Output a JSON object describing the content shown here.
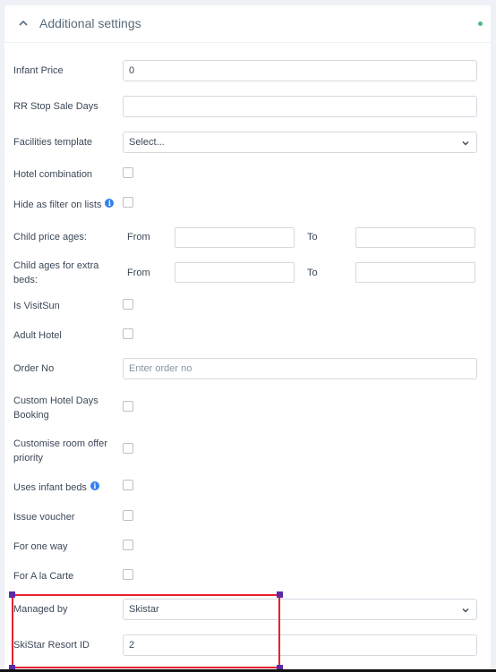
{
  "panel": {
    "title": "Additional settings",
    "status_color": "#52b788"
  },
  "fields": {
    "infant_price": {
      "label": "Infant Price",
      "value": "0"
    },
    "rr_stop_sale_days": {
      "label": "RR Stop Sale Days",
      "value": ""
    },
    "facilities_template": {
      "label": "Facilities template",
      "value": "Select..."
    },
    "hotel_combination": {
      "label": "Hotel combination",
      "checked": false
    },
    "hide_as_filter": {
      "label": "Hide as filter on lists",
      "checked": false,
      "info_icon": "i"
    },
    "child_price_ages": {
      "label": "Child price ages:",
      "from_label": "From",
      "to_label": "To",
      "from_value": "",
      "to_value": ""
    },
    "child_ages_extra_beds": {
      "label_line1": "Child ages for extra",
      "label_line2": "beds:",
      "from_label": "From",
      "to_label": "To",
      "from_value": "",
      "to_value": ""
    },
    "is_visitsun": {
      "label": "Is VisitSun",
      "checked": false
    },
    "adult_hotel": {
      "label": "Adult Hotel",
      "checked": false
    },
    "order_no": {
      "label": "Order No",
      "placeholder": "Enter order no",
      "value": ""
    },
    "custom_hotel_days": {
      "label_line1": "Custom Hotel Days",
      "label_line2": "Booking",
      "checked": false
    },
    "customise_room_offer": {
      "label_line1": "Customise room offer",
      "label_line2": "priority",
      "checked": false
    },
    "uses_infant_beds": {
      "label": "Uses infant beds",
      "checked": false,
      "info_icon": "i"
    },
    "issue_voucher": {
      "label": "Issue voucher",
      "checked": false
    },
    "for_one_way": {
      "label": "For one way",
      "checked": false
    },
    "for_a_la_carte": {
      "label": "For A la Carte",
      "checked": false
    },
    "managed_by": {
      "label": "Managed by",
      "value": "Skistar"
    },
    "skistar_resort_id": {
      "label": "SkiStar Resort ID",
      "value": "2"
    }
  },
  "icons": {
    "collapse": "chevron-up-icon",
    "dropdown": "chevron-down-icon",
    "info": "info-icon"
  },
  "highlight_color": "#e8202e"
}
